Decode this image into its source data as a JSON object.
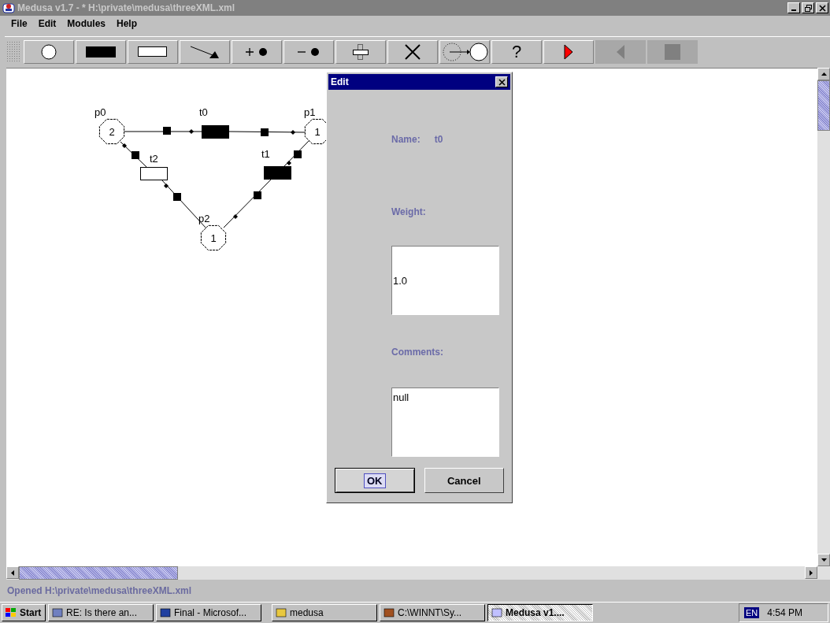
{
  "window": {
    "title": "Medusa v1.7 - * H:\\private\\medusa\\threeXML.xml",
    "active": false
  },
  "menu": [
    "File",
    "Edit",
    "Modules",
    "Help"
  ],
  "toolbar": [
    {
      "kind": "place",
      "disabled": false
    },
    {
      "kind": "transition",
      "disabled": false
    },
    {
      "kind": "empty-transition",
      "disabled": false
    },
    {
      "kind": "arc",
      "disabled": false
    },
    {
      "kind": "add-token",
      "disabled": false
    },
    {
      "kind": "remove-token",
      "disabled": false
    },
    {
      "kind": "move",
      "disabled": false
    },
    {
      "kind": "delete",
      "disabled": false
    },
    {
      "kind": "fire",
      "disabled": false
    },
    {
      "kind": "help",
      "label": "?",
      "disabled": false
    },
    {
      "kind": "play",
      "disabled": false
    },
    {
      "kind": "back",
      "disabled": true
    },
    {
      "kind": "stop",
      "disabled": true
    }
  ],
  "net": {
    "places": [
      {
        "label": "p0",
        "tokens": "2"
      },
      {
        "label": "p1",
        "tokens": "1"
      },
      {
        "label": "p2",
        "tokens": "1"
      }
    ],
    "transitions": [
      {
        "label": "t0",
        "filled": true
      },
      {
        "label": "t1",
        "filled": true
      },
      {
        "label": "t2",
        "filled": false
      }
    ]
  },
  "dialog": {
    "title": "Edit",
    "name_label": "Name:",
    "name_value": "t0",
    "weight_label": "Weight:",
    "weight_value": "1.0",
    "comments_label": "Comments:",
    "comments_value": "null",
    "buttons": [
      {
        "label": "OK",
        "focused": true
      },
      {
        "label": "Cancel",
        "focused": false
      }
    ]
  },
  "status_bar": "Opened H:\\private\\medusa\\threeXML.xml",
  "taskbar": {
    "start": "Start",
    "tasks": [
      {
        "label": "RE: Is there an...",
        "selected": false
      },
      {
        "label": "Final - Microsof...",
        "selected": false
      },
      {
        "label": "medusa",
        "selected": false
      },
      {
        "label": "C:\\WINNT\\Sy...",
        "selected": false
      },
      {
        "label": "Medusa v1....",
        "selected": true
      }
    ],
    "language": "EN",
    "clock": "4:54 PM"
  }
}
